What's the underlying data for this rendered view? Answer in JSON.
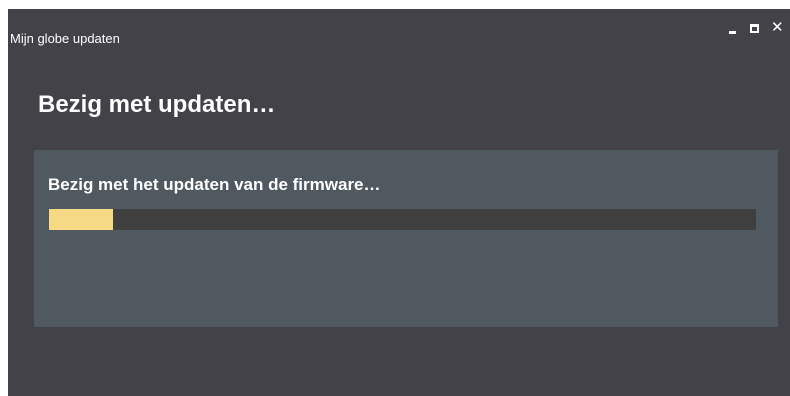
{
  "window": {
    "title": "Mijn globe updaten",
    "controls": {
      "minimize_icon": "minimize-icon",
      "maximize_icon": "maximize-icon",
      "close_glyph": "✕"
    }
  },
  "main": {
    "heading": "Bezig met updaten…",
    "status_text": "Bezig met het updaten van de firmware…",
    "progress_fraction": 0.09
  },
  "colors": {
    "window_bg": "#434249",
    "panel_bg": "#505860",
    "progress_track": "#3f3f3f",
    "progress_fill": "#f5d985",
    "text": "#ffffff"
  }
}
